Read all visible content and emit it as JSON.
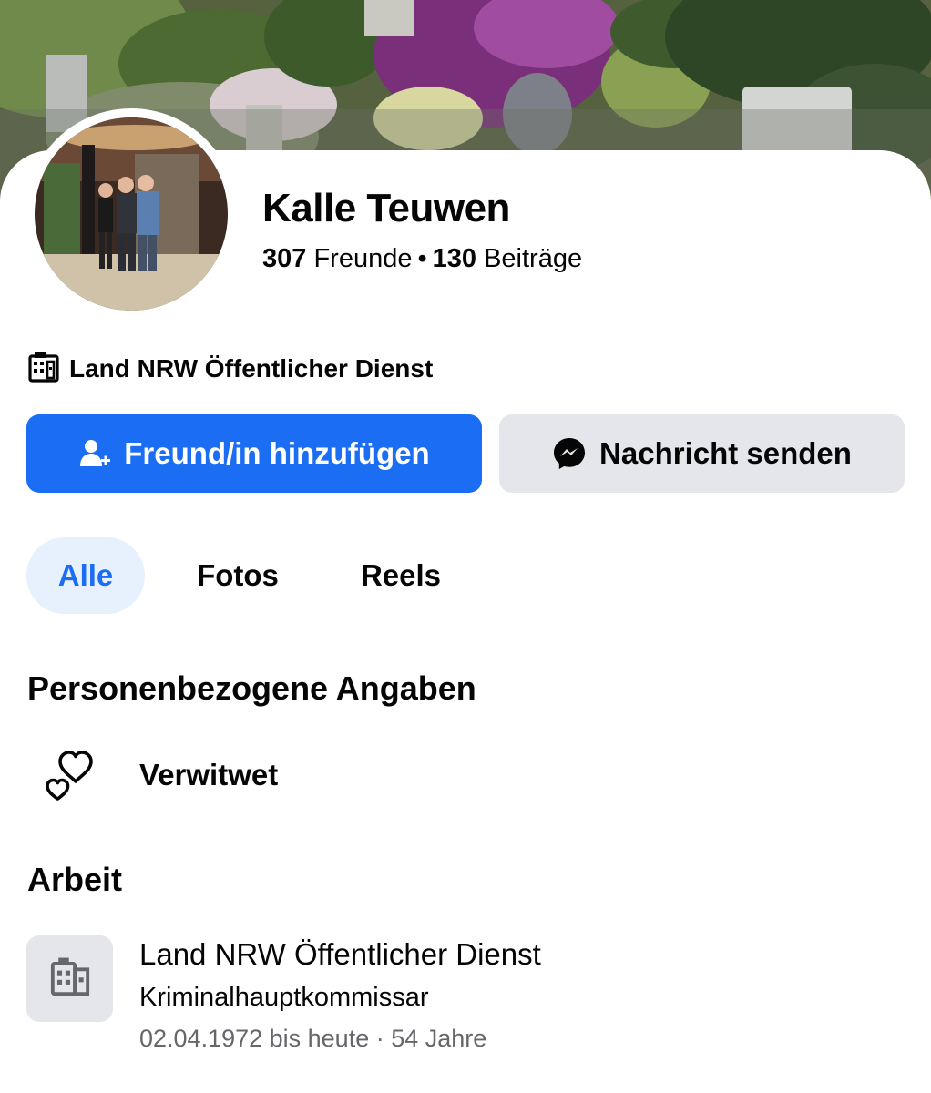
{
  "profile": {
    "name": "Kalle Teuwen",
    "friends_count": "307",
    "friends_label": "Freunde",
    "separator": "•",
    "posts_count": "130",
    "posts_label": "Beiträge",
    "workplace": "Land NRW Öffentlicher Dienst",
    "workplace_icon": "building-icon"
  },
  "actions": {
    "add_friend_label": "Freund/in hinzufügen",
    "add_friend_icon": "add-person-icon",
    "message_label": "Nachricht senden",
    "message_icon": "messenger-icon"
  },
  "tabs": [
    {
      "label": "Alle",
      "active": true
    },
    {
      "label": "Fotos",
      "active": false
    },
    {
      "label": "Reels",
      "active": false
    }
  ],
  "personal": {
    "title": "Personenbezogene Angaben",
    "relationship": "Verwitwet",
    "relationship_icon": "hearts-icon"
  },
  "work": {
    "title": "Arbeit",
    "company": "Land NRW Öffentlicher Dienst",
    "position": "Kriminalhauptkommissar",
    "period": "02.04.1972 bis heute · 54 Jahre",
    "icon": "building-icon"
  },
  "colors": {
    "primary": "#1b6ef3",
    "secondary_button": "#e4e6eb",
    "active_tab_bg": "#e7f0fd",
    "muted_text": "#65676b",
    "text": "#050505"
  }
}
